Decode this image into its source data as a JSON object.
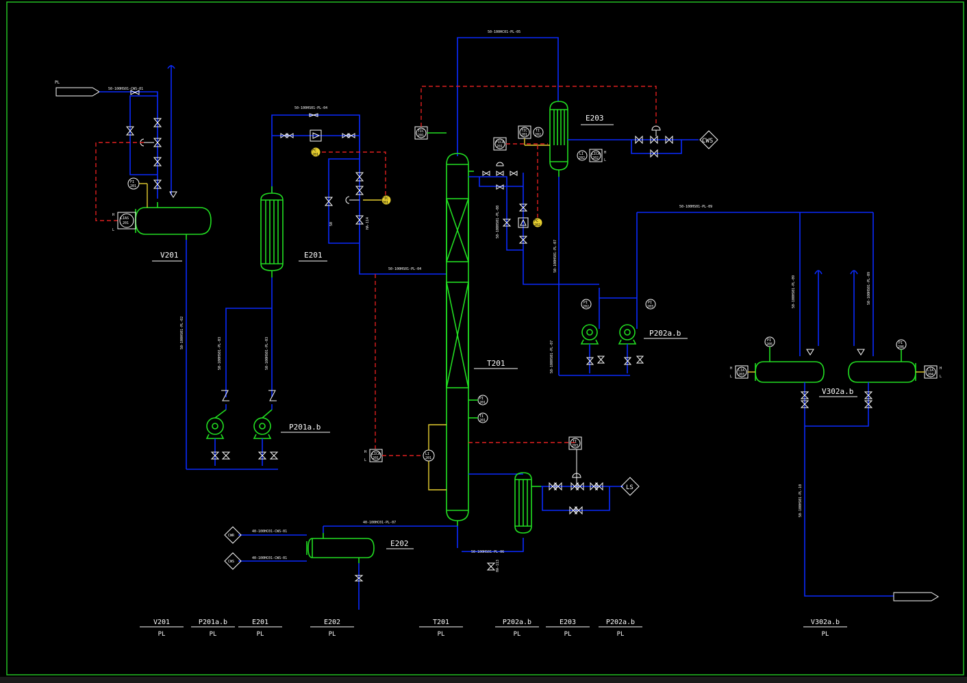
{
  "colors": {
    "pipe": "#0b2bff",
    "signal": "#e02020",
    "vessel": "#22e022",
    "text": "#ffffff",
    "highlight": "#e8d030",
    "border": "#22c022"
  },
  "equipment": {
    "v201": "V201",
    "e201": "E201",
    "e202": "E202",
    "e203": "E203",
    "t201": "T201",
    "p201": "P201a.b",
    "p202": "P202a.b",
    "v302": "V302a.b"
  },
  "pipes": {
    "cws01": "50-100HS01-CWS-01",
    "pl04a": "50-100HS01-PL-04",
    "pl04b": "50-100HS01-PL-04",
    "pl05": "50-100HC01-PL-05",
    "pl09": "50-100HS01-PL-09",
    "pl07": "40-100HC01-PL-07",
    "pl06": "50-100HS01-PL-06",
    "cws01b": "40-100HC01-CWS-01",
    "cws01c": "40-100HC01-CWS-01",
    "pl02": "50-100HS01-PL-02",
    "pl03a": "50-100HS01-PL-03",
    "pl03b": "50-100HS01-PL-03",
    "pl08": "50-100HS01-PL-08",
    "pl07b": "50-100HS01-PL-07",
    "pl07c": "50-100HS01-PL-07",
    "pl09b": "50-100HS01-PL-09",
    "pl09c": "50-100HS01-PL-09",
    "pl10": "50-100HS01-PL-10",
    "ha114": "HA-114",
    "ha113": "HA-113",
    "s50": "50"
  },
  "terminals": {
    "feed_in": "PL",
    "cws_right": "CWS",
    "ls": "LS",
    "cwr": "CWR",
    "cws_left": "CWS",
    "out_right": ""
  },
  "instruments": {
    "fi201": [
      "FI",
      "201"
    ],
    "lias201": [
      "LIAS",
      "201"
    ],
    "pi201": [
      "PI",
      "201"
    ],
    "ti201": [
      "TI",
      "201"
    ],
    "tic201": [
      "TIC",
      "201"
    ],
    "ticb": [
      "TIC",
      "201"
    ],
    "ti202": [
      "TI",
      "202"
    ],
    "fica201": [
      "FICA",
      "201"
    ],
    "li202": [
      "LI",
      "202"
    ],
    "lica202": [
      "LICA",
      "202"
    ],
    "pi202": [
      "PI",
      "202"
    ],
    "pi203": [
      "PI",
      "203"
    ],
    "pi204": [
      "PI",
      "204"
    ],
    "lica201": [
      "LICA",
      "201"
    ],
    "li201": [
      "LI",
      "201"
    ],
    "t203": [
      "TI",
      "203"
    ],
    "pi205": [
      "PI",
      "205"
    ],
    "pi206": [
      "PI",
      "206"
    ],
    "lia203": [
      "LIA",
      "203"
    ],
    "lia204": [
      "LIA",
      "204"
    ],
    "fc1": [
      "FC",
      "201"
    ],
    "fc2": [
      "FIC",
      "201"
    ],
    "fc3": [
      "FC",
      "202"
    ]
  },
  "hl": {
    "h": "H",
    "l": "L"
  },
  "legend": [
    {
      "tag": "V201",
      "desc": "PL"
    },
    {
      "tag": "P201a.b",
      "desc": "PL"
    },
    {
      "tag": "E201",
      "desc": "PL"
    },
    {
      "tag": "E202",
      "desc": "PL"
    },
    {
      "tag": "T201",
      "desc": "PL"
    },
    {
      "tag": "P202a.b",
      "desc": "PL"
    },
    {
      "tag": "E203",
      "desc": "PL"
    },
    {
      "tag": "P202a.b",
      "desc": "PL"
    },
    {
      "tag": "V302a.b",
      "desc": "PL"
    }
  ]
}
